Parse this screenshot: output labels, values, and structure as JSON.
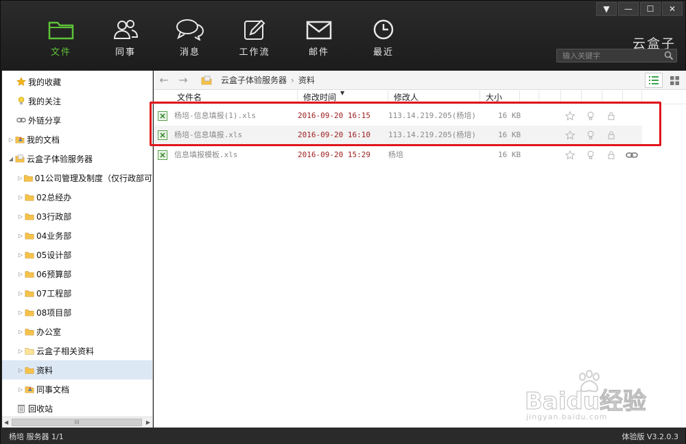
{
  "nav": {
    "items": [
      {
        "label": "文件",
        "icon": "folder-icon"
      },
      {
        "label": "同事",
        "icon": "people-icon"
      },
      {
        "label": "消息",
        "icon": "message-icon"
      },
      {
        "label": "工作流",
        "icon": "edit-icon"
      },
      {
        "label": "邮件",
        "icon": "mail-icon"
      },
      {
        "label": "最近",
        "icon": "clock-icon"
      }
    ],
    "active_color": "#5ec437"
  },
  "window": {
    "brand": "云盒子",
    "search_placeholder": "输入关键字"
  },
  "sidebar": {
    "items": [
      {
        "label": "我的收藏",
        "icon": "star-icon"
      },
      {
        "label": "我的关注",
        "icon": "bulb-icon"
      },
      {
        "label": "外链分享",
        "icon": "link-icon"
      },
      {
        "label": "我的文档",
        "icon": "user-folder-icon"
      },
      {
        "label": "云盒子体验服务器",
        "icon": "server-icon"
      },
      {
        "label": "01公司管理及制度（仅行政部可",
        "icon": "folder-icon"
      },
      {
        "label": "02总经办",
        "icon": "folder-icon"
      },
      {
        "label": "03行政部",
        "icon": "folder-icon"
      },
      {
        "label": "04业务部",
        "icon": "folder-icon"
      },
      {
        "label": "05设计部",
        "icon": "folder-icon"
      },
      {
        "label": "06预算部",
        "icon": "folder-icon"
      },
      {
        "label": "07工程部",
        "icon": "folder-icon"
      },
      {
        "label": "08项目部",
        "icon": "folder-icon"
      },
      {
        "label": "办公室",
        "icon": "folder-icon"
      },
      {
        "label": "云盒子相关资料",
        "icon": "folder-icon"
      },
      {
        "label": "资料",
        "icon": "folder-icon"
      },
      {
        "label": "同事文档",
        "icon": "user-folder-icon"
      },
      {
        "label": "回收站",
        "icon": "trash-icon"
      }
    ],
    "scroll_thumb": "III"
  },
  "main": {
    "breadcrumb": [
      "云盒子体验服务器",
      "资料"
    ],
    "breadcrumb_sep": "›",
    "columns": [
      "文件名",
      "修改时间",
      "修改人",
      "大小"
    ],
    "files": [
      {
        "name": "杨培-信息填报(1).xls",
        "time": "2016-09-20 16:15",
        "modifier": "113.14.219.205(杨培)",
        "size": "16 KB"
      },
      {
        "name": "杨培-信息填报.xls",
        "time": "2016-09-20 16:10",
        "modifier": "113.14.219.205(杨培)",
        "size": "16 KB"
      },
      {
        "name": "信息填报模板.xls",
        "time": "2016-09-20 15:29",
        "modifier": "杨培",
        "size": "16 KB"
      }
    ]
  },
  "status": {
    "left": "杨培   服务器 1/1",
    "right": "体验版 V3.2.0.3"
  },
  "watermark": {
    "text": "Baidu经验",
    "url": "jingyan.baidu.com"
  }
}
